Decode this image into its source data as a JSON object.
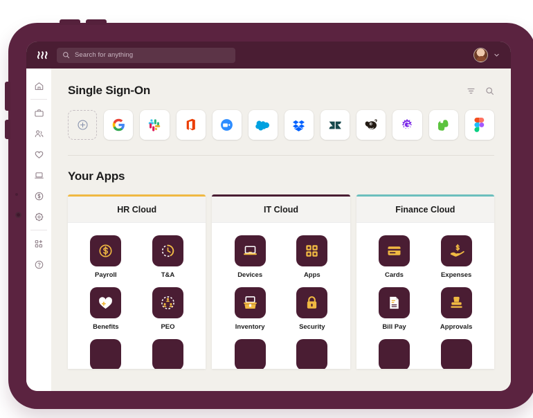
{
  "topbar": {
    "logo_name": "rippling-logo",
    "search_placeholder": "Search for anything",
    "search_value": "",
    "avatar_name": "user-avatar",
    "chevron_name": "chevron-down-icon"
  },
  "sidebar": {
    "items": [
      {
        "icon": "home-icon",
        "name": "sidebar-item-home"
      },
      {
        "icon": "briefcase-icon",
        "name": "sidebar-item-work"
      },
      {
        "icon": "people-icon",
        "name": "sidebar-item-people"
      },
      {
        "icon": "heart-icon",
        "name": "sidebar-item-benefits"
      },
      {
        "icon": "laptop-icon",
        "name": "sidebar-item-devices"
      },
      {
        "icon": "dollar-circle-icon",
        "name": "sidebar-item-finance"
      },
      {
        "icon": "gear-icon",
        "name": "sidebar-item-settings"
      },
      {
        "icon": "add-apps-icon",
        "name": "sidebar-item-add-apps"
      },
      {
        "icon": "help-circle-icon",
        "name": "sidebar-item-help"
      }
    ]
  },
  "sso": {
    "title": "Single Sign-On",
    "filter_icon": "filter-icon",
    "search_icon": "search-icon",
    "apps": [
      {
        "name": "add-sso-app",
        "label": "Add",
        "icon": "plus-circle-icon"
      },
      {
        "name": "sso-google",
        "label": "Google",
        "icon": "google-logo"
      },
      {
        "name": "sso-slack",
        "label": "Slack",
        "icon": "slack-logo"
      },
      {
        "name": "sso-office",
        "label": "Microsoft Office",
        "icon": "office-logo"
      },
      {
        "name": "sso-zoom",
        "label": "Zoom",
        "icon": "zoom-logo"
      },
      {
        "name": "sso-salesforce",
        "label": "Salesforce",
        "icon": "salesforce-logo"
      },
      {
        "name": "sso-dropbox",
        "label": "Dropbox",
        "icon": "dropbox-logo"
      },
      {
        "name": "sso-zendesk",
        "label": "Zendesk",
        "icon": "zendesk-logo"
      },
      {
        "name": "sso-mailchimp",
        "label": "Mailchimp",
        "icon": "mailchimp-logo"
      },
      {
        "name": "sso-starburst",
        "label": "Starburst App",
        "icon": "starburst-logo"
      },
      {
        "name": "sso-evernote",
        "label": "Evernote",
        "icon": "evernote-logo"
      },
      {
        "name": "sso-figma",
        "label": "Figma",
        "icon": "figma-logo"
      }
    ]
  },
  "your_apps": {
    "title": "Your Apps",
    "cards": [
      {
        "title": "HR Cloud",
        "accent": "#f0b942",
        "apps": [
          {
            "label": "Payroll",
            "icon": "dollar-circle-icon"
          },
          {
            "label": "T&A",
            "icon": "clock-icon"
          },
          {
            "label": "Benefits",
            "icon": "heart-plus-icon"
          },
          {
            "label": "PEO",
            "icon": "people-circle-icon"
          }
        ]
      },
      {
        "title": "IT Cloud",
        "accent": "#4a1d33",
        "apps": [
          {
            "label": "Devices",
            "icon": "laptop-icon"
          },
          {
            "label": "Apps",
            "icon": "grid-apps-icon"
          },
          {
            "label": "Inventory",
            "icon": "inventory-box-icon"
          },
          {
            "label": "Security",
            "icon": "padlock-icon"
          }
        ]
      },
      {
        "title": "Finance Cloud",
        "accent": "#6bbfbd",
        "apps": [
          {
            "label": "Cards",
            "icon": "credit-card-icon"
          },
          {
            "label": "Expenses",
            "icon": "hand-dollar-icon"
          },
          {
            "label": "Bill Pay",
            "icon": "invoice-icon"
          },
          {
            "label": "Approvals",
            "icon": "stamp-icon"
          }
        ]
      }
    ]
  },
  "colors": {
    "brand_maroon": "#4a1d33",
    "bezel": "#5b2340",
    "canvas": "#f2f0eb",
    "icon_gold": "#f0b942",
    "hr_accent": "#f0b942",
    "it_accent": "#4a1d33",
    "finance_accent": "#6bbfbd"
  }
}
